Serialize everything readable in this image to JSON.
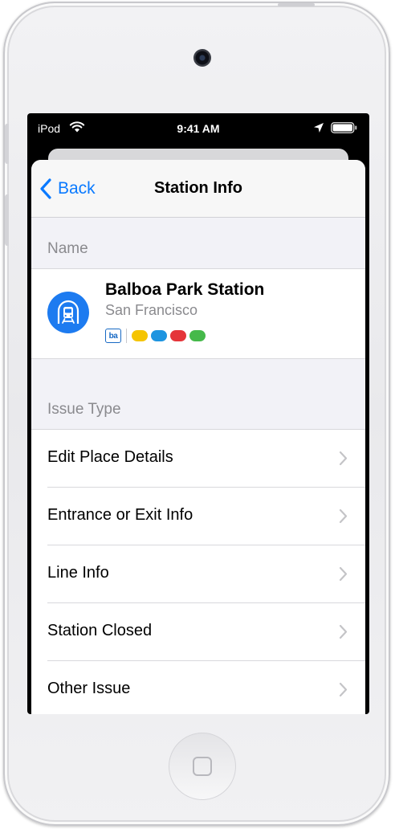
{
  "status_bar": {
    "carrier": "iPod",
    "time": "9:41 AM"
  },
  "nav": {
    "back_label": "Back",
    "title": "Station Info"
  },
  "sections": {
    "name_header": "Name",
    "issue_header": "Issue Type"
  },
  "station": {
    "name": "Balboa Park Station",
    "city": "San Francisco",
    "agency_logo_text": "ba",
    "line_colors": [
      "#f5c400",
      "#1d94e0",
      "#e5353a",
      "#45b94a"
    ]
  },
  "issue_types": [
    {
      "label": "Edit Place Details"
    },
    {
      "label": "Entrance or Exit Info"
    },
    {
      "label": "Line Info"
    },
    {
      "label": "Station Closed"
    },
    {
      "label": "Other Issue"
    }
  ],
  "colors": {
    "accent": "#0a7aff",
    "transit_icon_bg": "#1d7bf0"
  }
}
